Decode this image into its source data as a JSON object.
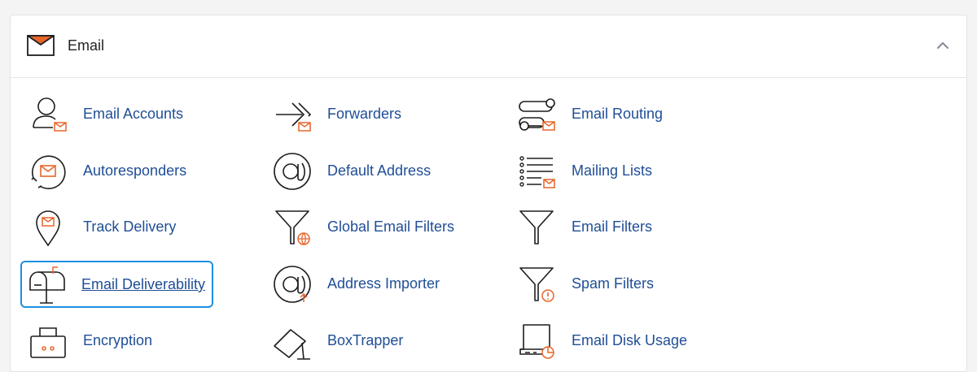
{
  "section": {
    "title": "Email",
    "icon": "envelope-icon",
    "collapse_icon": "chevron-up-icon"
  },
  "colors": {
    "link": "#1f4e96",
    "accent": "#e8652a",
    "focus": "#1d8fe0",
    "icon_stroke": "#1d1d1f"
  },
  "items": [
    {
      "label": "Email Accounts",
      "icon": "user-mail-icon"
    },
    {
      "label": "Forwarders",
      "icon": "forward-arrow-icon"
    },
    {
      "label": "Email Routing",
      "icon": "routing-icon"
    },
    {
      "label": "Autoresponders",
      "icon": "autoresponder-icon"
    },
    {
      "label": "Default Address",
      "icon": "at-sign-icon"
    },
    {
      "label": "Mailing Lists",
      "icon": "list-mail-icon"
    },
    {
      "label": "Track Delivery",
      "icon": "location-pin-icon"
    },
    {
      "label": "Global Email Filters",
      "icon": "globe-filter-icon"
    },
    {
      "label": "Email Filters",
      "icon": "filter-icon"
    },
    {
      "label": "Email Deliverability",
      "icon": "mailbox-icon"
    },
    {
      "label": "Address Importer",
      "icon": "at-import-icon"
    },
    {
      "label": "Spam Filters",
      "icon": "spam-filter-icon"
    },
    {
      "label": "Encryption",
      "icon": "lock-box-icon"
    },
    {
      "label": "BoxTrapper",
      "icon": "boxtrapper-icon"
    },
    {
      "label": "Email Disk Usage",
      "icon": "disk-usage-icon"
    }
  ]
}
